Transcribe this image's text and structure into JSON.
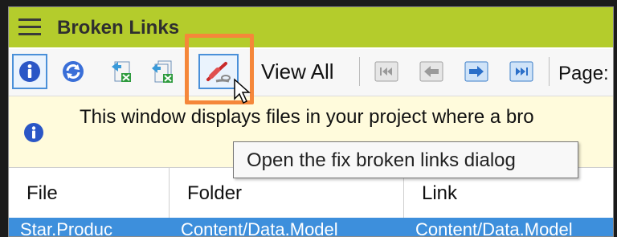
{
  "window": {
    "title": "Broken Links"
  },
  "toolbar": {
    "buttons": [
      {
        "icon": "info-icon"
      },
      {
        "icon": "refresh-icon"
      },
      {
        "icon": "export-icon"
      },
      {
        "icon": "export-all-icon"
      },
      {
        "icon": "fix-links-icon"
      }
    ],
    "view_all_label": "View All",
    "nav_icons": [
      "first-page-icon",
      "previous-page-icon",
      "next-page-icon",
      "last-page-icon"
    ],
    "page_label": "Page:"
  },
  "info_bar": {
    "text": "This window displays files in your project where a bro"
  },
  "table": {
    "columns": [
      "File",
      "Folder",
      "Link"
    ],
    "selected_row": [
      "Star.Produc",
      "Content/Data.Model",
      "Content/Data.Model"
    ]
  },
  "tooltip": {
    "text": "Open the fix broken links dialog"
  },
  "colors": {
    "title_bar": "#b4cc2c",
    "info_bar": "#fffbdc",
    "selected_row": "#3d8fdc",
    "callout_highlight": "#f5873a"
  }
}
